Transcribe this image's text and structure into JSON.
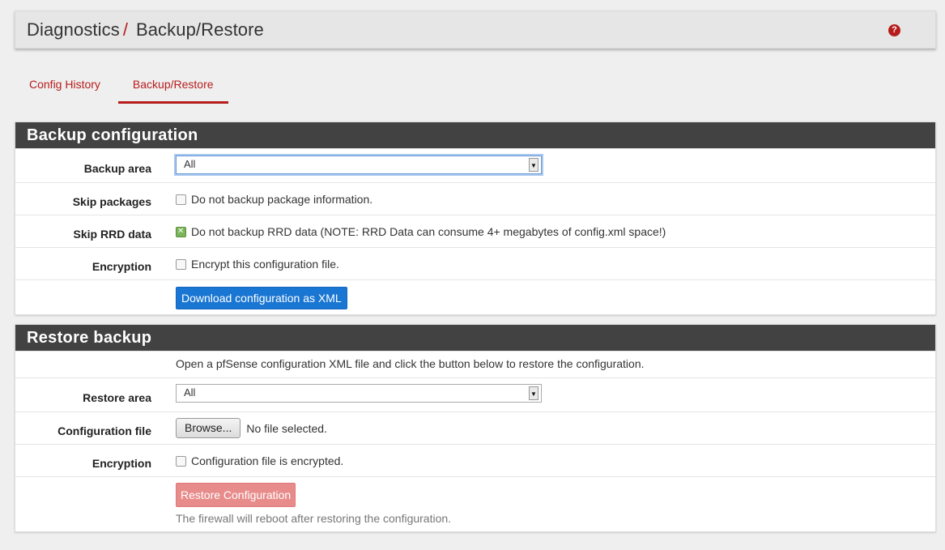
{
  "breadcrumb": {
    "parent": "Diagnostics",
    "separator": "/",
    "current": "Backup/Restore",
    "help_icon": "question-circle-icon"
  },
  "tabs": [
    {
      "label": "Config History",
      "active": false
    },
    {
      "label": "Backup/Restore",
      "active": true
    }
  ],
  "backup": {
    "title": "Backup configuration",
    "area_label": "Backup area",
    "area_value": "All",
    "skip_packages_label": "Skip packages",
    "skip_packages_text": "Do not backup package information.",
    "skip_packages_checked": false,
    "skip_rrd_label": "Skip RRD data",
    "skip_rrd_text": "Do not backup RRD data (NOTE: RRD Data can consume 4+ megabytes of config.xml space!)",
    "skip_rrd_checked": true,
    "encryption_label": "Encryption",
    "encryption_text": "Encrypt this configuration file.",
    "encryption_checked": false,
    "download_button": "Download configuration as XML"
  },
  "restore": {
    "title": "Restore backup",
    "intro": "Open a pfSense configuration XML file and click the button below to restore the configuration.",
    "area_label": "Restore area",
    "area_value": "All",
    "file_label": "Configuration file",
    "browse_button": "Browse...",
    "file_status": "No file selected.",
    "encryption_label": "Encryption",
    "encryption_text": "Configuration file is encrypted.",
    "encryption_checked": false,
    "restore_button": "Restore Configuration",
    "reboot_note": "The firewall will reboot after restoring the configuration."
  },
  "colors": {
    "accent": "#b71c1c",
    "panel_heading": "#424242",
    "primary_button": "#1976d2",
    "danger_disabled": "#e88b8b"
  }
}
